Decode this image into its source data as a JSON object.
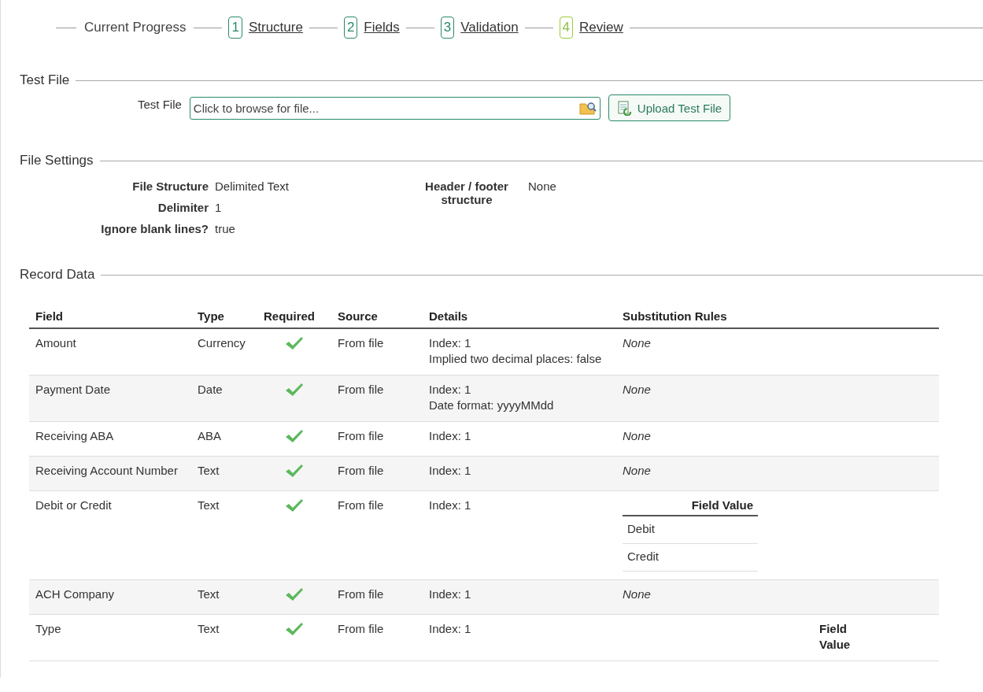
{
  "progress": {
    "label": "Current Progress",
    "steps": [
      {
        "number": "1",
        "label": "Structure",
        "selected": false
      },
      {
        "number": "2",
        "label": "Fields",
        "selected": false
      },
      {
        "number": "3",
        "label": "Validation",
        "selected": false
      },
      {
        "number": "4",
        "label": "Review",
        "selected": true
      }
    ]
  },
  "test_file": {
    "title": "Test File",
    "field_label": "Test File",
    "placeholder": "Click to browse for file...",
    "button": "Upload Test File"
  },
  "file_settings": {
    "title": "File Settings",
    "left": [
      {
        "label": "File Structure",
        "value": "Delimited Text"
      },
      {
        "label": "Delimiter",
        "value": "1"
      },
      {
        "label": "Ignore blank lines?",
        "value": "true"
      }
    ],
    "right": [
      {
        "label": "Header / footer structure",
        "value": "None"
      }
    ]
  },
  "record_data": {
    "title": "Record Data",
    "columns": [
      "Field",
      "Type",
      "Required",
      "Source",
      "Details",
      "Substitution Rules"
    ],
    "rows": [
      {
        "field": "Amount",
        "type": "Currency",
        "required": true,
        "source": "From file",
        "details": [
          "Index: 1",
          "Implied two decimal places: false"
        ],
        "substitution": {
          "kind": "none",
          "text": "None"
        }
      },
      {
        "field": "Payment Date",
        "type": "Date",
        "required": true,
        "source": "From file",
        "details": [
          "Index: 1",
          "Date format: yyyyMMdd"
        ],
        "substitution": {
          "kind": "none",
          "text": "None"
        }
      },
      {
        "field": "Receiving ABA",
        "type": "ABA",
        "required": true,
        "source": "From file",
        "details": [
          "Index: 1"
        ],
        "substitution": {
          "kind": "none",
          "text": "None"
        }
      },
      {
        "field": "Receiving Account Number",
        "type": "Text",
        "required": true,
        "source": "From file",
        "details": [
          "Index: 1"
        ],
        "substitution": {
          "kind": "none",
          "text": "None"
        }
      },
      {
        "field": "Debit or Credit",
        "type": "Text",
        "required": true,
        "source": "From file",
        "details": [
          "Index: 1"
        ],
        "substitution": {
          "kind": "table",
          "header": "Field Value",
          "values": [
            "Debit",
            "Credit"
          ]
        }
      },
      {
        "field": "ACH Company",
        "type": "Text",
        "required": true,
        "source": "From file",
        "details": [
          "Index: 1"
        ],
        "substitution": {
          "kind": "none",
          "text": "None"
        }
      },
      {
        "field": "Type",
        "type": "Text",
        "required": true,
        "source": "From file",
        "details": [
          "Index: 1"
        ],
        "substitution": {
          "kind": "wide-table",
          "header": "Field Value"
        }
      }
    ]
  }
}
